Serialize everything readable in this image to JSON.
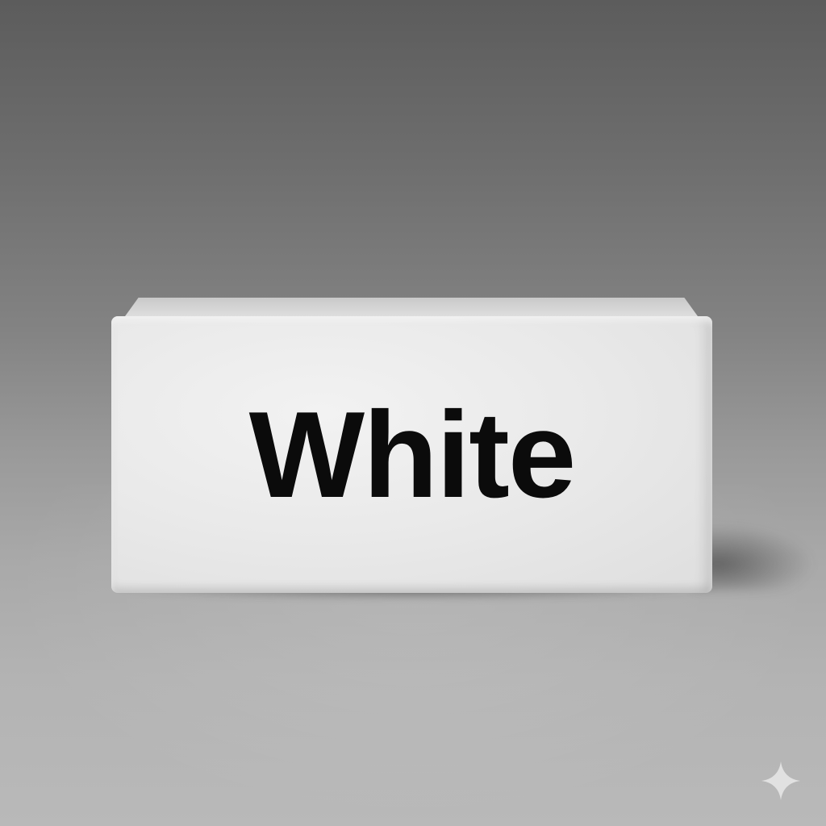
{
  "scene": {
    "description_colors": {
      "background_top": "#5c5c5c",
      "background_bottom": "#b9b9b9",
      "block_face": "#eaeaea",
      "text": "#0b0b0b"
    },
    "block": {
      "label": "White"
    },
    "watermark": {
      "icon": "sparkle-icon"
    }
  }
}
